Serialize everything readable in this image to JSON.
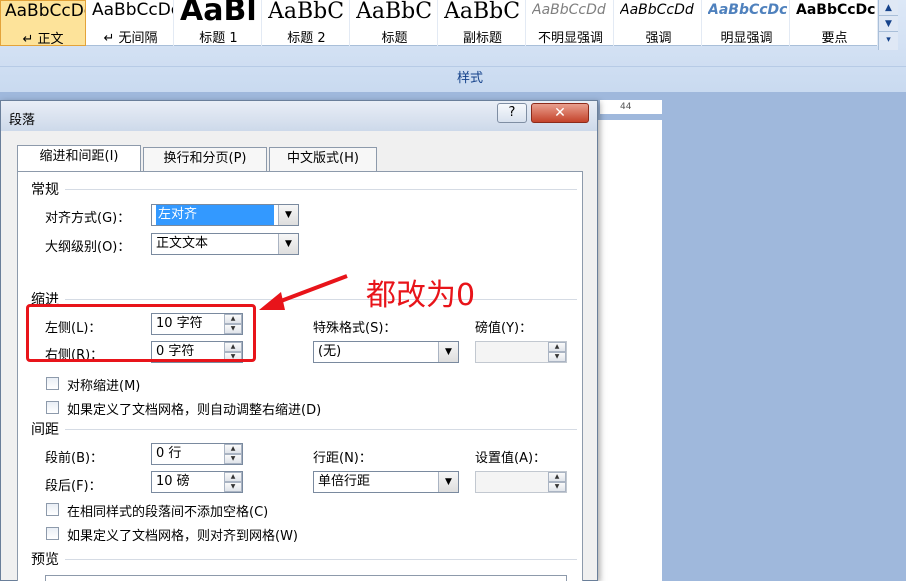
{
  "styles": [
    {
      "preview": "AaBbCcDc",
      "name": "↵ 正文",
      "selected": true
    },
    {
      "preview": "AaBbCcDc",
      "name": "↵ 无间隔",
      "selected": false
    },
    {
      "preview": "AaBl",
      "name": "标题 1",
      "selected": false
    },
    {
      "preview": "AaBbC",
      "name": "标题 2",
      "selected": false
    },
    {
      "preview": "AaBbC",
      "name": "标题",
      "selected": false
    },
    {
      "preview": "AaBbC",
      "name": "副标题",
      "selected": false
    },
    {
      "preview": "AaBbCcDd",
      "name": "不明显强调",
      "selected": false
    },
    {
      "preview": "AaBbCcDd",
      "name": "强调",
      "selected": false
    },
    {
      "preview": "AaBbCcDc",
      "name": "明显强调",
      "selected": false
    },
    {
      "preview": "AaBbCcDc",
      "name": "要点",
      "selected": false
    }
  ],
  "ribbon": {
    "group_label": "样式",
    "scroll_up": "▲",
    "scroll_down": "▼",
    "more": "▾"
  },
  "ruler": {
    "mark": "44"
  },
  "dialog": {
    "title": "段落",
    "help": "?",
    "close": "✕",
    "tabs": [
      "缩进和间距(I)",
      "换行和分页(P)",
      "中文版式(H)"
    ],
    "general": {
      "section": "常规",
      "alignment_label": "对齐方式(G)：",
      "alignment_value": "左对齐",
      "outline_label": "大纲级别(O)：",
      "outline_value": "正文文本"
    },
    "indent": {
      "section": "缩进",
      "left_label": "左侧(L)：",
      "left_value": "10 字符",
      "right_label": "右侧(R)：",
      "right_value": "0 字符",
      "special_label": "特殊格式(S)：",
      "special_value": "(无)",
      "by_label": "磅值(Y)：",
      "by_value": "",
      "mirror_label": "对称缩进(M)",
      "auto_label": "如果定义了文档网格，则自动调整右缩进(D)"
    },
    "spacing": {
      "section": "间距",
      "before_label": "段前(B)：",
      "before_value": "0 行",
      "after_label": "段后(F)：",
      "after_value": "10 磅",
      "line_label": "行距(N)：",
      "line_value": "单倍行距",
      "at_label": "设置值(A)：",
      "at_value": "",
      "no_space_label": "在相同样式的段落间不添加空格(C)",
      "snap_label": "如果定义了文档网格，则对齐到网格(W)"
    },
    "preview": {
      "section": "预览"
    }
  },
  "annotation": {
    "text": "都改为0",
    "color": "#e8141a"
  }
}
